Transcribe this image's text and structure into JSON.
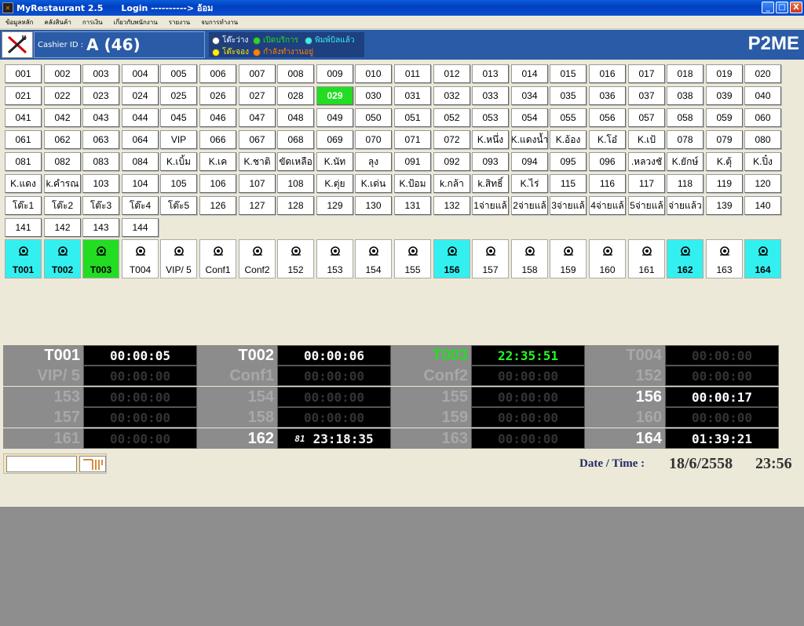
{
  "window": {
    "title": "MyRestaurant 2.5      Login ----------> อ้อม",
    "min_label": "_",
    "max_label": "□",
    "close_label": "X"
  },
  "menu": [
    "ข้อมูลหลัก",
    "คลังสินค้า",
    "การเงิน",
    "เกี่ยวกับพนักงาน",
    "รายงาน",
    "จบการทำงาน"
  ],
  "header": {
    "cashier_label": "Cashier ID :",
    "cashier_value": "A (46)",
    "brand": "P2ME",
    "legend": [
      {
        "label": "โต๊ะว่าง",
        "color": "#FFFFFF"
      },
      {
        "label": "เปิดบริการ",
        "color": "#22DD22"
      },
      {
        "label": "พิมพ์บิลแล้ว",
        "color": "#33F0F0"
      },
      {
        "label": "โต๊ะจอง",
        "color": "#FFEE00"
      },
      {
        "label": "กำลังทำงานอยู่",
        "color": "#FF8000"
      }
    ]
  },
  "tables": [
    [
      "001",
      "002",
      "003",
      "004",
      "005",
      "006",
      "007",
      "008",
      "009",
      "010",
      "011",
      "012",
      "013",
      "014",
      "015",
      "016",
      "017",
      "018",
      "019",
      "020"
    ],
    [
      "021",
      "022",
      "023",
      "024",
      "025",
      "026",
      "027",
      "028",
      "029",
      "030",
      "031",
      "032",
      "033",
      "034",
      "035",
      "036",
      "037",
      "038",
      "039",
      "040"
    ],
    [
      "041",
      "042",
      "043",
      "044",
      "045",
      "046",
      "047",
      "048",
      "049",
      "050",
      "051",
      "052",
      "053",
      "054",
      "055",
      "056",
      "057",
      "058",
      "059",
      "060"
    ],
    [
      "061",
      "062",
      "063",
      "064",
      "VIP",
      "066",
      "067",
      "068",
      "069",
      "070",
      "071",
      "072",
      "K.หนึ่ง",
      "K.แดงน้ำ",
      "K.อ้อง",
      "K.โอ๋",
      "K.เป้",
      "078",
      "079",
      "080"
    ],
    [
      "081",
      "082",
      "083",
      "084",
      "K.เบิ้ม",
      "K.เค",
      "K.ชาติ",
      "ขัดเหลือ",
      "K.นัท",
      "ลุง",
      "091",
      "092",
      "093",
      "094",
      "095",
      "096",
      ".หลวงชั",
      "K.ยักษ์",
      "K.ตุ้",
      "K.ปิ๋ง"
    ],
    [
      "K.แดง",
      "k.คำรณ",
      "103",
      "104",
      "105",
      "106",
      "107",
      "108",
      "K.ตุ่ย",
      "K.เด่น",
      "K.ป้อม",
      "k.กล้า",
      "k.สิทธิ์",
      "K.ไร่",
      "115",
      "116",
      "117",
      "118",
      "119",
      "120"
    ],
    [
      "โต๊ะ1",
      "โต๊ะ2",
      "โต๊ะ3",
      "โต๊ะ4",
      "โต๊ะ5",
      "126",
      "127",
      "128",
      "129",
      "130",
      "131",
      "132",
      "1จ่ายแล้",
      "2จ่ายแล้",
      "3จ่ายแล้",
      "4จ่ายแล้",
      "5จ่ายแล้",
      "จ่ายแล้ว",
      "139",
      "140"
    ],
    [
      "141",
      "142",
      "143",
      "144"
    ]
  ],
  "active_table": "029",
  "vip_rooms": [
    {
      "label": "T001",
      "status": "cyan"
    },
    {
      "label": "T002",
      "status": "cyan"
    },
    {
      "label": "T003",
      "status": "green"
    },
    {
      "label": "T004",
      "status": "free"
    },
    {
      "label": "VIP/ 5",
      "status": "free"
    },
    {
      "label": "Conf1",
      "status": "free"
    },
    {
      "label": "Conf2",
      "status": "free"
    },
    {
      "label": "152",
      "status": "free"
    },
    {
      "label": "153",
      "status": "free"
    },
    {
      "label": "154",
      "status": "free"
    },
    {
      "label": "155",
      "status": "free"
    },
    {
      "label": "156",
      "status": "cyan"
    },
    {
      "label": "157",
      "status": "free"
    },
    {
      "label": "158",
      "status": "free"
    },
    {
      "label": "159",
      "status": "free"
    },
    {
      "label": "160",
      "status": "free"
    },
    {
      "label": "161",
      "status": "free"
    },
    {
      "label": "162",
      "status": "cyan"
    },
    {
      "label": "163",
      "status": "free"
    },
    {
      "label": "164",
      "status": "cyan"
    }
  ],
  "timers": [
    [
      {
        "name": "T001",
        "time": "00:00:05",
        "state": "on"
      },
      {
        "name": "T002",
        "time": "00:00:06",
        "state": "on"
      },
      {
        "name": "T003",
        "time": "22:35:51",
        "state": "green"
      },
      {
        "name": "T004",
        "time": "00:00:00",
        "state": "off"
      }
    ],
    [
      {
        "name": "VIP/ 5",
        "time": "00:00:00",
        "state": "off"
      },
      {
        "name": "Conf1",
        "time": "00:00:00",
        "state": "off"
      },
      {
        "name": "Conf2",
        "time": "00:00:00",
        "state": "off"
      },
      {
        "name": "152",
        "time": "00:00:00",
        "state": "off"
      }
    ],
    [
      {
        "name": "153",
        "time": "00:00:00",
        "state": "off"
      },
      {
        "name": "154",
        "time": "00:00:00",
        "state": "off"
      },
      {
        "name": "155",
        "time": "00:00:00",
        "state": "off"
      },
      {
        "name": "156",
        "time": "00:00:17",
        "state": "on"
      }
    ],
    [
      {
        "name": "157",
        "time": "00:00:00",
        "state": "off"
      },
      {
        "name": "158",
        "time": "00:00:00",
        "state": "off"
      },
      {
        "name": "159",
        "time": "00:00:00",
        "state": "off"
      },
      {
        "name": "160",
        "time": "00:00:00",
        "state": "off"
      }
    ],
    [
      {
        "name": "161",
        "time": "00:00:00",
        "state": "off"
      },
      {
        "name": "162",
        "time": "23:18:35",
        "state": "on",
        "prefix": "81"
      },
      {
        "name": "163",
        "time": "00:00:00",
        "state": "off"
      },
      {
        "name": "164",
        "time": "01:39:21",
        "state": "on"
      }
    ]
  ],
  "search": {
    "value": "",
    "placeholder": ""
  },
  "datetime": {
    "label": "Date / Time :",
    "date": "18/6/2558",
    "time": "23:56"
  }
}
